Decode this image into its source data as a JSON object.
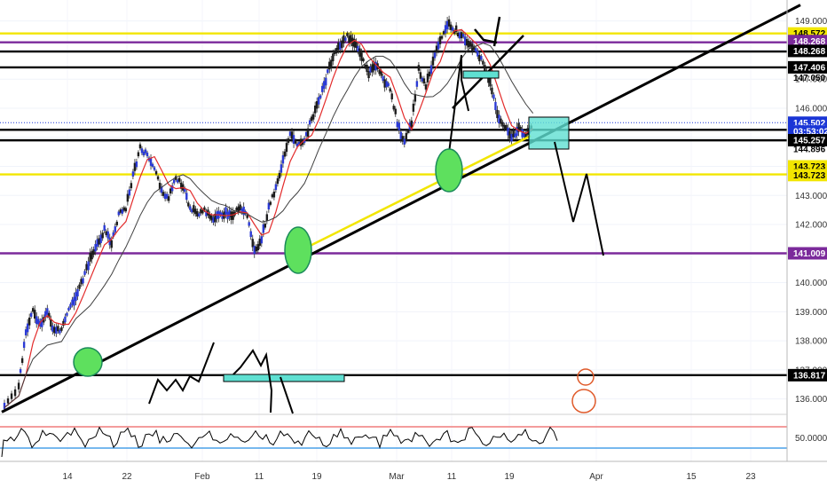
{
  "chart_data": {
    "type": "candlestick",
    "price_axis": {
      "range": [
        135.5,
        149.6
      ],
      "ticks": [
        "136.000",
        "137.000",
        "138.000",
        "139.000",
        "140.000",
        "141.000",
        "142.000",
        "143.000",
        "144.000",
        "145.000",
        "146.000",
        "147.000",
        "148.000",
        "149.000"
      ]
    },
    "time_axis": {
      "ticks": [
        "14",
        "22",
        "Feb",
        "11",
        "19",
        "Mar",
        "11",
        "19",
        "Apr",
        "15",
        "23"
      ]
    },
    "price_labels": [
      {
        "text": "148.572",
        "value": 148.572,
        "color": "#f2e600"
      },
      {
        "text": "148.268",
        "value": 148.31,
        "color": "#7b2a9b"
      },
      {
        "text": "148.268",
        "value": 147.97,
        "color": "#000000"
      },
      {
        "text": "147.406",
        "value": 147.406,
        "color": "#000000"
      },
      {
        "text": "147.050",
        "value": 147.05,
        "color": "none"
      },
      {
        "text": "145.502",
        "value": 145.502,
        "color": "#1a35d6"
      },
      {
        "text": "03:53:02",
        "value": 145.2,
        "color": "#1a35d6"
      },
      {
        "text": "145.257",
        "value": 144.9,
        "color": "#000000"
      },
      {
        "text": "144.896",
        "value": 144.6,
        "color": "none"
      },
      {
        "text": "143.723",
        "value": 144.0,
        "color": "#f2e600"
      },
      {
        "text": "143.723",
        "value": 143.7,
        "color": "#f2e600"
      },
      {
        "text": "141.009",
        "value": 141.009,
        "color": "#7b2a9b"
      },
      {
        "text": "136.817",
        "value": 136.817,
        "color": "#000000"
      }
    ],
    "horizontal_levels": [
      {
        "value": 148.572,
        "color": "#f2e600"
      },
      {
        "value": 148.268,
        "color": "#7b2a9b"
      },
      {
        "value": 147.95,
        "color": "#000000"
      },
      {
        "value": 147.406,
        "color": "#000000"
      },
      {
        "value": 145.502,
        "color": "#1a35d6"
      },
      {
        "value": 145.257,
        "color": "#000000"
      },
      {
        "value": 144.896,
        "color": "#000000"
      },
      {
        "value": 143.723,
        "color": "#f2e600"
      },
      {
        "value": 141.009,
        "color": "#7b2a9b"
      },
      {
        "value": 136.817,
        "color": "#000000"
      }
    ],
    "price_series": [
      {
        "x": 0,
        "y": 135.7
      },
      {
        "x": 2,
        "y": 136.5
      },
      {
        "x": 3,
        "y": 138.3
      },
      {
        "x": 4,
        "y": 139.0
      },
      {
        "x": 5,
        "y": 138.6
      },
      {
        "x": 6,
        "y": 139.0
      },
      {
        "x": 7,
        "y": 138.3
      },
      {
        "x": 8,
        "y": 138.4
      },
      {
        "x": 9,
        "y": 139.0
      },
      {
        "x": 10,
        "y": 139.5
      },
      {
        "x": 11,
        "y": 140.1
      },
      {
        "x": 12,
        "y": 140.8
      },
      {
        "x": 13,
        "y": 141.3
      },
      {
        "x": 14,
        "y": 141.8
      },
      {
        "x": 15,
        "y": 141.4
      },
      {
        "x": 16,
        "y": 142.3
      },
      {
        "x": 17,
        "y": 142.6
      },
      {
        "x": 18,
        "y": 143.7
      },
      {
        "x": 19,
        "y": 144.6
      },
      {
        "x": 20,
        "y": 144.4
      },
      {
        "x": 21,
        "y": 144.0
      },
      {
        "x": 22,
        "y": 143.2
      },
      {
        "x": 23,
        "y": 142.9
      },
      {
        "x": 24,
        "y": 143.6
      },
      {
        "x": 25,
        "y": 143.3
      },
      {
        "x": 26,
        "y": 142.6
      },
      {
        "x": 27,
        "y": 142.3
      },
      {
        "x": 28,
        "y": 142.5
      },
      {
        "x": 29,
        "y": 142.2
      },
      {
        "x": 30,
        "y": 142.3
      },
      {
        "x": 31,
        "y": 142.4
      },
      {
        "x": 32,
        "y": 142.3
      },
      {
        "x": 33,
        "y": 142.6
      },
      {
        "x": 34,
        "y": 142.3
      },
      {
        "x": 35,
        "y": 141.1
      },
      {
        "x": 36,
        "y": 141.5
      },
      {
        "x": 37,
        "y": 142.6
      },
      {
        "x": 38,
        "y": 143.2
      },
      {
        "x": 39,
        "y": 144.2
      },
      {
        "x": 40,
        "y": 145.1
      },
      {
        "x": 41,
        "y": 144.7
      },
      {
        "x": 42,
        "y": 144.9
      },
      {
        "x": 43,
        "y": 145.6
      },
      {
        "x": 44,
        "y": 146.3
      },
      {
        "x": 45,
        "y": 147.0
      },
      {
        "x": 46,
        "y": 147.8
      },
      {
        "x": 47,
        "y": 148.2
      },
      {
        "x": 48,
        "y": 148.5
      },
      {
        "x": 49,
        "y": 148.3
      },
      {
        "x": 50,
        "y": 147.8
      },
      {
        "x": 51,
        "y": 147.2
      },
      {
        "x": 52,
        "y": 147.5
      },
      {
        "x": 53,
        "y": 147.0
      },
      {
        "x": 54,
        "y": 146.7
      },
      {
        "x": 55,
        "y": 145.5
      },
      {
        "x": 56,
        "y": 144.8
      },
      {
        "x": 57,
        "y": 145.5
      },
      {
        "x": 58,
        "y": 147.3
      },
      {
        "x": 59,
        "y": 146.8
      },
      {
        "x": 60,
        "y": 147.6
      },
      {
        "x": 61,
        "y": 148.4
      },
      {
        "x": 62,
        "y": 148.9
      },
      {
        "x": 63,
        "y": 148.7
      },
      {
        "x": 64,
        "y": 148.5
      },
      {
        "x": 65,
        "y": 148.2
      },
      {
        "x": 66,
        "y": 148.0
      },
      {
        "x": 67,
        "y": 147.6
      },
      {
        "x": 68,
        "y": 146.9
      },
      {
        "x": 69,
        "y": 145.8
      },
      {
        "x": 70,
        "y": 145.4
      },
      {
        "x": 71,
        "y": 145.0
      },
      {
        "x": 72,
        "y": 145.3
      },
      {
        "x": 73,
        "y": 145.1
      },
      {
        "x": 74,
        "y": 145.5
      }
    ]
  }
}
